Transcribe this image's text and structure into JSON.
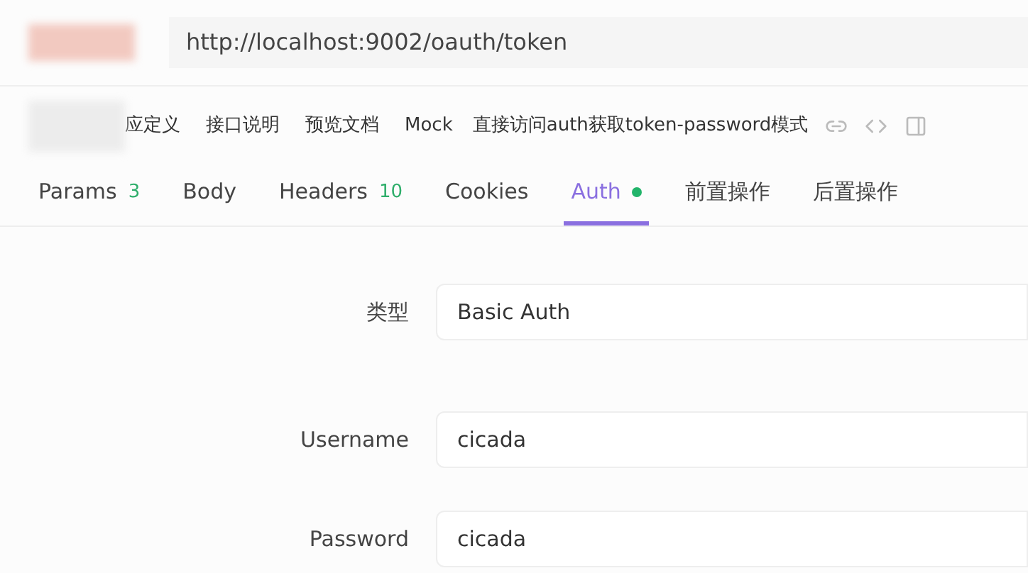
{
  "url_bar": {
    "value": "http://localhost:9002/oauth/token"
  },
  "toolbar": {
    "items": [
      "应定义",
      "接口说明",
      "预览文档",
      "Mock"
    ],
    "title": "直接访问auth获取token-password模式"
  },
  "tabs": [
    {
      "label": "Params",
      "count": "3",
      "selected": false,
      "dot": false
    },
    {
      "label": "Body",
      "selected": false,
      "dot": false
    },
    {
      "label": "Headers",
      "count": "10",
      "selected": false,
      "dot": false
    },
    {
      "label": "Cookies",
      "selected": false,
      "dot": false
    },
    {
      "label": "Auth",
      "selected": true,
      "dot": true
    },
    {
      "label": "前置操作",
      "selected": false,
      "dot": false
    },
    {
      "label": "后置操作",
      "selected": false,
      "dot": false
    }
  ],
  "form": [
    {
      "label": "类型",
      "value": "Basic Auth"
    },
    {
      "label": "Username",
      "value": "cicada"
    },
    {
      "label": "Password",
      "value": "cicada"
    }
  ]
}
